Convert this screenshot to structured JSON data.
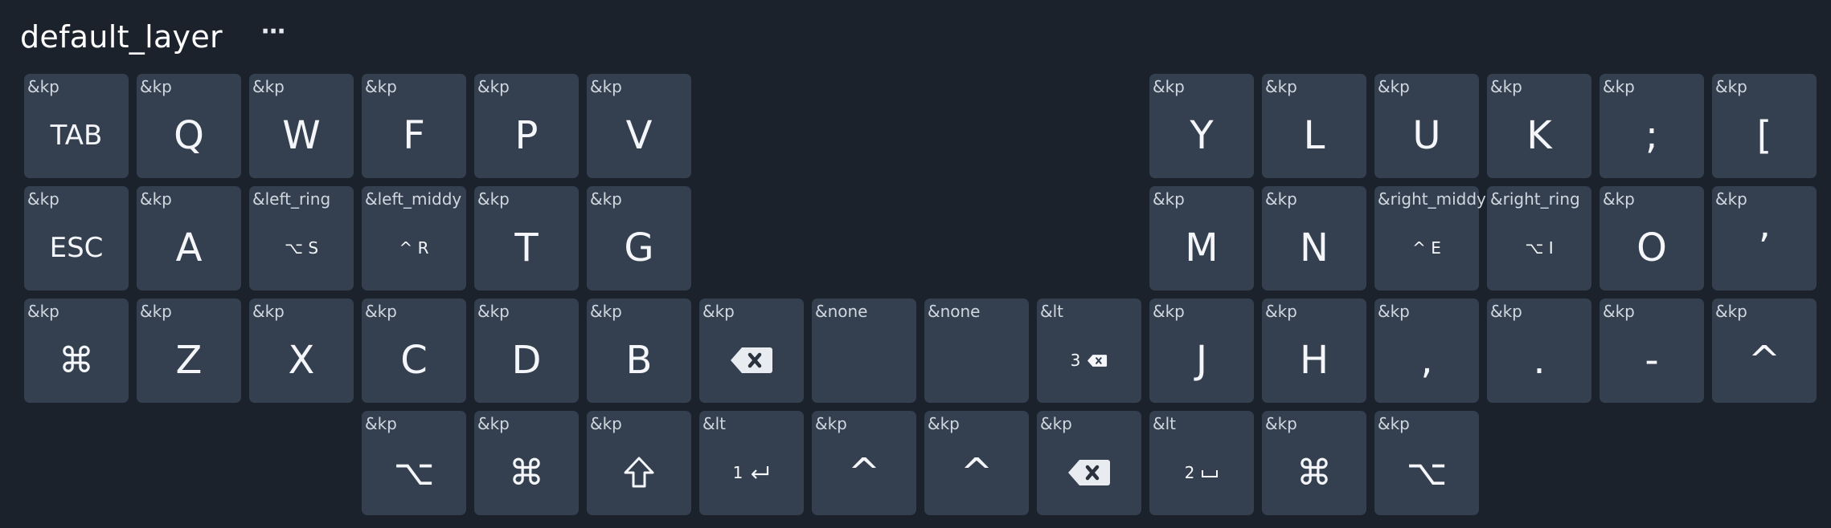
{
  "header": {
    "layer_name": "default_layer",
    "menu_label": "⋯"
  },
  "keys": [
    {
      "b": "&kp",
      "l": "TAB",
      "t": "mid"
    },
    {
      "b": "&kp",
      "l": "Q",
      "t": "big"
    },
    {
      "b": "&kp",
      "l": "W",
      "t": "big"
    },
    {
      "b": "&kp",
      "l": "F",
      "t": "big"
    },
    {
      "b": "&kp",
      "l": "P",
      "t": "big"
    },
    {
      "b": "&kp",
      "l": "V",
      "t": "big"
    },
    {
      "b": "&kp",
      "l": "Y",
      "t": "big"
    },
    {
      "b": "&kp",
      "l": "L",
      "t": "big"
    },
    {
      "b": "&kp",
      "l": "U",
      "t": "big"
    },
    {
      "b": "&kp",
      "l": "K",
      "t": "big"
    },
    {
      "b": "&kp",
      "l": ";",
      "t": "big"
    },
    {
      "b": "&kp",
      "l": "[",
      "t": "big"
    },
    {
      "b": "&kp",
      "l": "ESC",
      "t": "mid"
    },
    {
      "b": "&kp",
      "l": "A",
      "t": "big"
    },
    {
      "b": "&left_ring",
      "l": "⌥ S",
      "t": "small"
    },
    {
      "b": "&left_middy",
      "l": "^ R",
      "t": "small"
    },
    {
      "b": "&kp",
      "l": "T",
      "t": "big"
    },
    {
      "b": "&kp",
      "l": "G",
      "t": "big"
    },
    {
      "b": "&kp",
      "l": "M",
      "t": "big"
    },
    {
      "b": "&kp",
      "l": "N",
      "t": "big"
    },
    {
      "b": "&right_middy",
      "l": "^ E",
      "t": "small"
    },
    {
      "b": "&right_ring",
      "l": "⌥ I",
      "t": "small"
    },
    {
      "b": "&kp",
      "l": "O",
      "t": "big"
    },
    {
      "b": "&kp",
      "l": "’",
      "t": "big"
    },
    {
      "b": "&kp",
      "l": "⌘",
      "t": "sym"
    },
    {
      "b": "&kp",
      "l": "Z",
      "t": "big"
    },
    {
      "b": "&kp",
      "l": "X",
      "t": "big"
    },
    {
      "b": "&kp",
      "l": "C",
      "t": "big"
    },
    {
      "b": "&kp",
      "l": "D",
      "t": "big"
    },
    {
      "b": "&kp",
      "l": "B",
      "t": "big"
    },
    {
      "b": "&kp",
      "l": "",
      "t": "icon",
      "icon": "backspace-icon"
    },
    {
      "b": "&none",
      "l": "",
      "t": "empty"
    },
    {
      "b": "&none",
      "l": "",
      "t": "empty"
    },
    {
      "b": "&lt",
      "l": "3",
      "t": "sub",
      "icon": "backspace-icon"
    },
    {
      "b": "&kp",
      "l": "J",
      "t": "big"
    },
    {
      "b": "&kp",
      "l": "H",
      "t": "big"
    },
    {
      "b": "&kp",
      "l": ",",
      "t": "big"
    },
    {
      "b": "&kp",
      "l": ".",
      "t": "big"
    },
    {
      "b": "&kp",
      "l": "-",
      "t": "big"
    },
    {
      "b": "&kp",
      "l": "^",
      "t": "big"
    },
    {
      "b": "&kp",
      "l": "⌥",
      "t": "sym"
    },
    {
      "b": "&kp",
      "l": "⌘",
      "t": "sym"
    },
    {
      "b": "&kp",
      "l": "",
      "t": "icon",
      "icon": "shift-icon"
    },
    {
      "b": "&lt",
      "l": "1",
      "t": "sub",
      "icon": "enter-icon"
    },
    {
      "b": "&kp",
      "l": "^",
      "t": "big"
    },
    {
      "b": "&kp",
      "l": "^",
      "t": "big"
    },
    {
      "b": "&kp",
      "l": "",
      "t": "icon",
      "icon": "backspace-icon"
    },
    {
      "b": "&lt",
      "l": "2",
      "t": "sub",
      "icon": "space-icon"
    },
    {
      "b": "&kp",
      "l": "⌘",
      "t": "sym"
    },
    {
      "b": "&kp",
      "l": "⌥",
      "t": "sym"
    }
  ]
}
